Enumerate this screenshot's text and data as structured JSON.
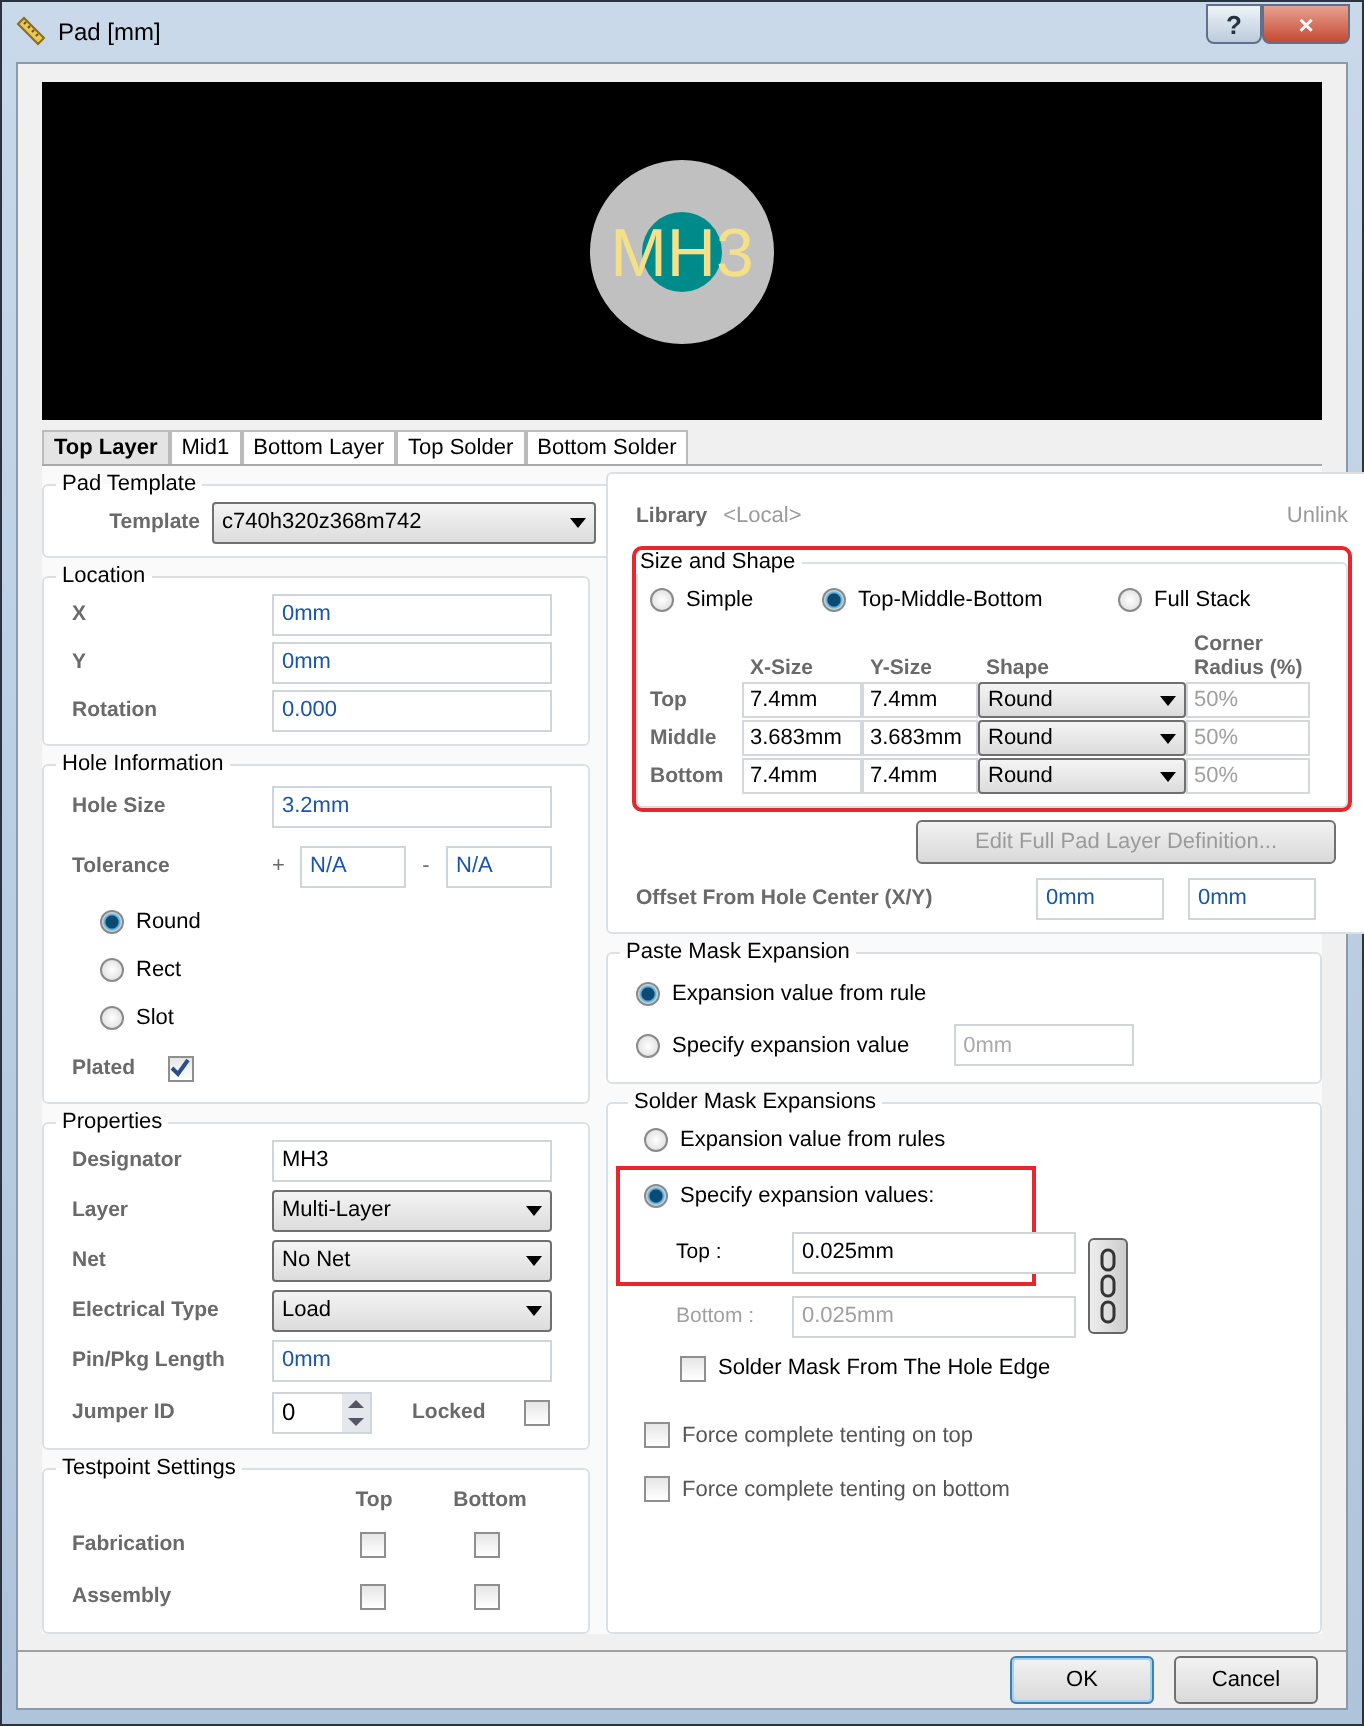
{
  "window": {
    "title": "Pad [mm]",
    "help": "?",
    "close": "×"
  },
  "preview": {
    "label": "MH3"
  },
  "tabs": [
    {
      "label": "Top Layer",
      "selected": true
    },
    {
      "label": "Mid1",
      "selected": false
    },
    {
      "label": "Bottom Layer",
      "selected": false
    },
    {
      "label": "Top Solder",
      "selected": false
    },
    {
      "label": "Bottom Solder",
      "selected": false
    }
  ],
  "pad_template": {
    "title": "Pad Template",
    "template_label": "Template",
    "template_value": "c740h320z368m742",
    "library_label": "Library",
    "library_value": "<Local>",
    "unlink": "Unlink"
  },
  "location": {
    "title": "Location",
    "fields": [
      {
        "label": "X",
        "value": "0mm"
      },
      {
        "label": "Y",
        "value": "0mm"
      },
      {
        "label": "Rotation",
        "value": "0.000"
      }
    ]
  },
  "hole_information": {
    "title": "Hole Information",
    "hole_size_label": "Hole Size",
    "hole_size": "3.2mm",
    "tolerance_label": "Tolerance",
    "plus_sign": "+",
    "plus_value": "N/A",
    "minus_sign": "-",
    "minus_value": "N/A",
    "shapes": [
      {
        "label": "Round",
        "selected": true
      },
      {
        "label": "Rect",
        "selected": false
      },
      {
        "label": "Slot",
        "selected": false
      }
    ],
    "plated": {
      "label": "Plated",
      "checked": true
    }
  },
  "properties": {
    "title": "Properties",
    "rows": [
      {
        "kind": "text",
        "label": "Designator",
        "value": "MH3"
      },
      {
        "kind": "select",
        "label": "Layer",
        "value": "Multi-Layer"
      },
      {
        "kind": "select",
        "label": "Net",
        "value": "No Net"
      },
      {
        "kind": "select",
        "label": "Electrical Type",
        "value": "Load"
      },
      {
        "kind": "unit",
        "label": "Pin/Pkg Length",
        "value": "0mm"
      }
    ],
    "jumper_label": "Jumper ID",
    "jumper_value": "0",
    "locked": {
      "label": "Locked",
      "checked": false
    }
  },
  "testpoint": {
    "title": "Testpoint Settings",
    "columns": [
      "Top",
      "Bottom"
    ],
    "rows": [
      {
        "label": "Fabrication",
        "top": false,
        "bottom": false
      },
      {
        "label": "Assembly",
        "top": false,
        "bottom": false
      }
    ]
  },
  "size_and_shape": {
    "title": "Size and Shape",
    "highlighted": true,
    "modes": [
      {
        "label": "Simple",
        "selected": false
      },
      {
        "label": "Top-Middle-Bottom",
        "selected": true
      },
      {
        "label": "Full Stack",
        "selected": false
      }
    ],
    "columns": [
      "X-Size",
      "Y-Size",
      "Shape",
      "Corner Radius (%)"
    ],
    "rows": [
      {
        "layer": "Top",
        "x": "7.4mm",
        "y": "7.4mm",
        "shape": "Round",
        "corner": "50%"
      },
      {
        "layer": "Middle",
        "x": "3.683mm",
        "y": "3.683mm",
        "shape": "Round",
        "corner": "50%"
      },
      {
        "layer": "Bottom",
        "x": "7.4mm",
        "y": "7.4mm",
        "shape": "Round",
        "corner": "50%"
      }
    ],
    "edit_button": "Edit Full Pad Layer Definition...",
    "edit_disabled": true,
    "offset_label": "Offset From Hole Center (X/Y)",
    "offset_x": "0mm",
    "offset_y": "0mm"
  },
  "paste_mask": {
    "title": "Paste Mask Expansion",
    "options": [
      {
        "label": "Expansion value from rule",
        "selected": true
      },
      {
        "label": "Specify expansion value",
        "selected": false
      }
    ],
    "value": "0mm"
  },
  "solder_mask": {
    "title": "Solder Mask Expansions",
    "options": [
      {
        "label": "Expansion value from rules",
        "selected": false
      },
      {
        "label": "Specify expansion values:",
        "selected": true
      }
    ],
    "highlighted": true,
    "top_label": "Top :",
    "top_value": "0.025mm",
    "bottom_label": "Bottom :",
    "bottom_value": "0.025mm",
    "bottom_disabled": true,
    "hole_edge": {
      "label": "Solder Mask From The Hole Edge",
      "checked": false
    },
    "tenting": [
      {
        "label": "Force complete tenting on top",
        "checked": false
      },
      {
        "label": "Force complete tenting on bottom",
        "checked": false
      }
    ]
  },
  "buttons": [
    {
      "label": "OK",
      "default": true
    },
    {
      "label": "Cancel",
      "default": false
    }
  ]
}
